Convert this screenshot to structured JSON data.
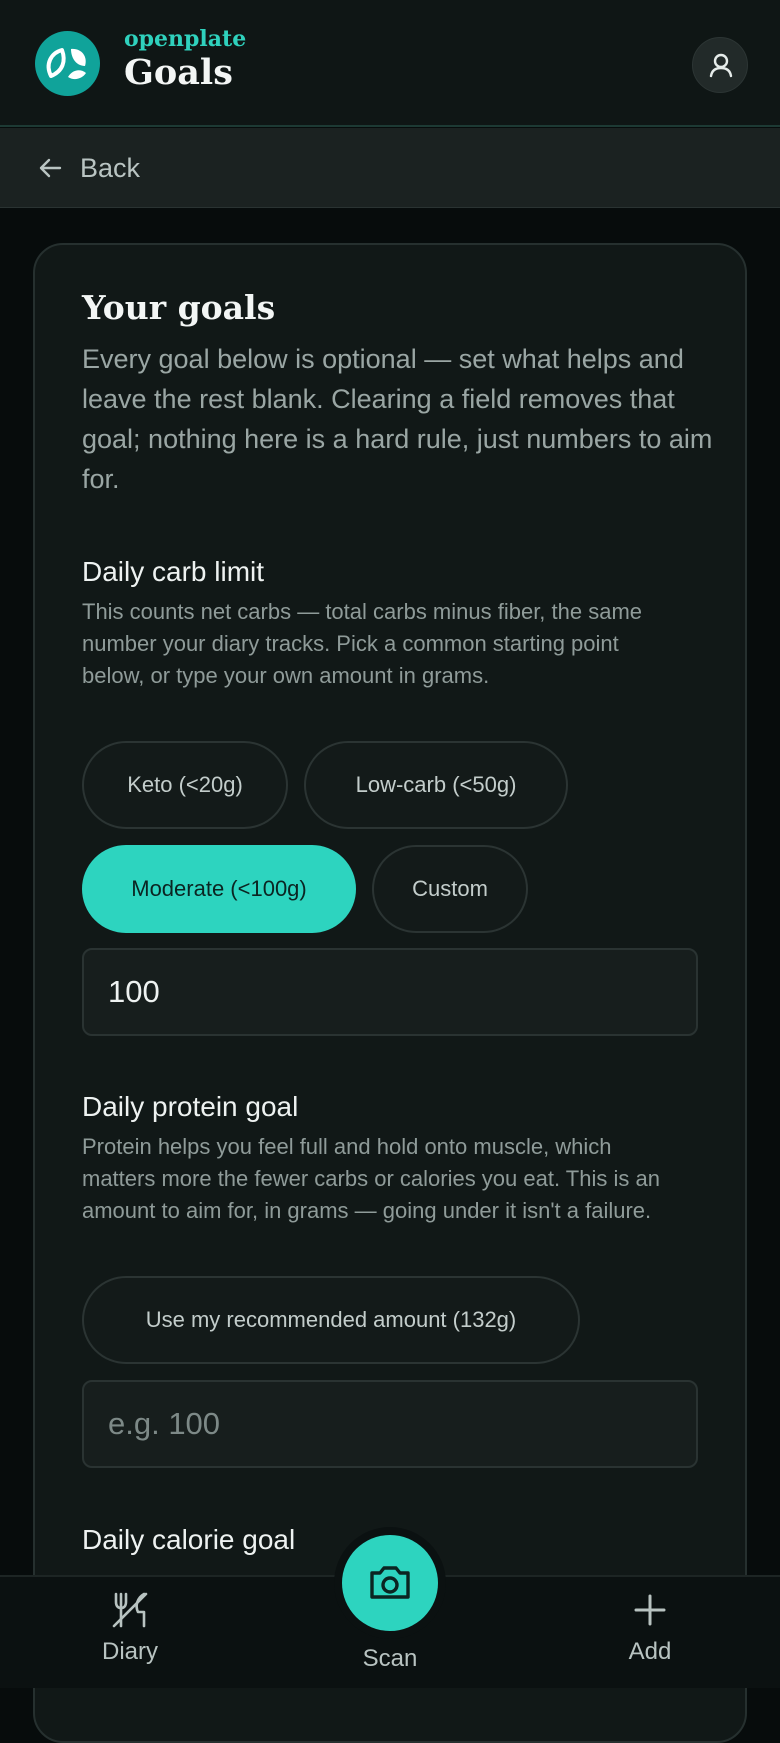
{
  "header": {
    "brand": "openplate",
    "title": "Goals"
  },
  "backbar": {
    "label": "Back"
  },
  "card": {
    "title": "Your goals",
    "intro": "Every goal below is optional — set what helps and leave the rest blank. Clearing a field removes that goal; nothing here is a hard rule, just numbers to aim for."
  },
  "carb": {
    "label": "Daily carb limit",
    "description": "This counts net carbs — total carbs minus fiber, the same number your diary tracks. Pick a common starting point below, or type your own amount in grams.",
    "options": [
      "Keto (<20g)",
      "Low-carb (<50g)",
      "Moderate (<100g)",
      "Custom"
    ],
    "selected": "Moderate (<100g)",
    "value": "100"
  },
  "protein": {
    "label": "Daily protein goal",
    "description": "Protein helps you feel full and hold onto muscle, which matters more the fewer carbs or calories you eat. This is an amount to aim for, in grams — going under it isn't a failure.",
    "recommend_label": "Use my recommended amount (132g)",
    "value": "",
    "placeholder": "e.g. 100"
  },
  "calorie": {
    "label": "Daily calorie goal"
  },
  "nav": {
    "diary": "Diary",
    "scan": "Scan",
    "add": "Add"
  },
  "colors": {
    "accent": "#2dd4bf",
    "logo": "#10a39a",
    "background": "#070c0c",
    "card": "#111817"
  },
  "icons": [
    "leaf-logo-icon",
    "user-icon",
    "arrow-left-icon",
    "fork-knife-icon",
    "camera-icon",
    "plus-icon"
  ]
}
